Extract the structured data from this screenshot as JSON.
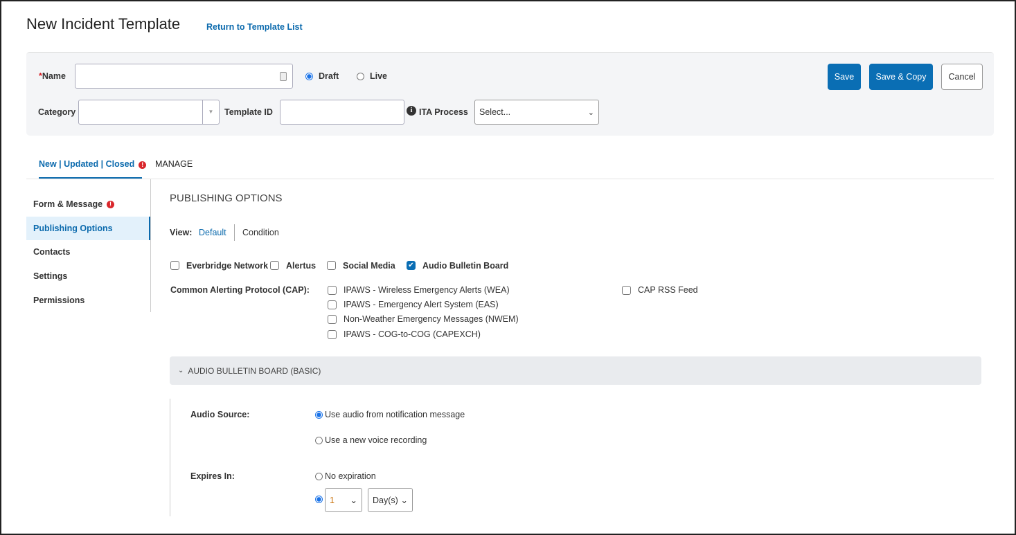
{
  "header": {
    "title": "New Incident Template",
    "return_link": "Return to Template List"
  },
  "form": {
    "name_label": "Name",
    "required_mark": "*",
    "name_value": "",
    "status_options": [
      {
        "label": "Draft",
        "selected": true
      },
      {
        "label": "Live",
        "selected": false
      }
    ],
    "category_label": "Category",
    "category_value": "",
    "template_id_label": "Template ID",
    "template_id_value": "",
    "ita_label": "ITA Process",
    "ita_value": "Select...",
    "save": "Save",
    "save_copy": "Save & Copy",
    "cancel": "Cancel"
  },
  "tabs": [
    {
      "label": "New | Updated | Closed",
      "active": true,
      "error": true
    },
    {
      "label": "MANAGE",
      "active": false
    }
  ],
  "sidebar": {
    "items": [
      {
        "label": "Form & Message",
        "error": true
      },
      {
        "label": "Publishing Options",
        "active": true
      },
      {
        "label": "Contacts"
      },
      {
        "label": "Settings"
      },
      {
        "label": "Permissions"
      }
    ]
  },
  "main": {
    "heading": "PUBLISHING OPTIONS",
    "view_label": "View:",
    "view_default": "Default",
    "view_condition": "Condition",
    "channels": [
      {
        "label": "Everbridge Network",
        "checked": false
      },
      {
        "label": "Alertus",
        "checked": false
      },
      {
        "label": "Social Media",
        "checked": false
      },
      {
        "label": "Audio Bulletin Board",
        "checked": true
      }
    ],
    "cap_label": "Common Alerting Protocol (CAP):",
    "cap_options": [
      {
        "label": "IPAWS - Wireless Emergency Alerts (WEA)",
        "checked": false
      },
      {
        "label": "IPAWS - Emergency Alert System (EAS)",
        "checked": false
      },
      {
        "label": "Non-Weather Emergency Messages (NWEM)",
        "checked": false
      },
      {
        "label": "IPAWS - COG-to-COG (CAPEXCH)",
        "checked": false
      }
    ],
    "cap_rss": {
      "label": "CAP RSS Feed",
      "checked": false
    },
    "section_title": "AUDIO BULLETIN BOARD (BASIC)",
    "audio_source_label": "Audio Source:",
    "audio_options": [
      {
        "label": "Use audio from notification message",
        "selected": true
      },
      {
        "label": "Use a new voice recording",
        "selected": false
      }
    ],
    "expires_label": "Expires In:",
    "no_expiration": "No expiration",
    "expire_amount": "1",
    "expire_unit": "Day(s)"
  },
  "colors": {
    "accent": "#0a6eb4",
    "error": "#d9262b"
  }
}
